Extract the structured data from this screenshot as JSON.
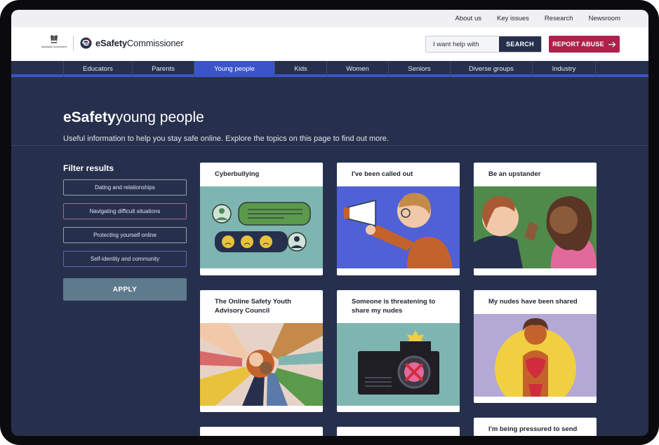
{
  "utility_nav": [
    "About us",
    "Key issues",
    "Research",
    "Newsroom"
  ],
  "header": {
    "crest_text": "Australian Government",
    "brand_bold": "eSafety",
    "brand_rest": "Commissioner",
    "search_placeholder": "I want help with",
    "search_button": "SEARCH",
    "report_button": "REPORT ABUSE"
  },
  "nav": {
    "items": [
      "Educators",
      "Parents",
      "Young people",
      "Kids",
      "Women",
      "Seniors",
      "Diverse groups",
      "Industry"
    ],
    "active": "Young people"
  },
  "hero": {
    "title_bold": "eSafety",
    "title_rest": "young people",
    "subtitle": "Useful information to help you stay safe online. Explore the topics on this page to find out more."
  },
  "filters": {
    "title": "Filter results",
    "options": [
      "Dating and relationships",
      "Navigating difficult situations",
      "Protecting yourself online",
      "Self-identity and community"
    ],
    "apply": "APPLY"
  },
  "cards": [
    {
      "title": "Cyberbullying",
      "icon": "chat-bubbles-illustration",
      "bg": "#7fb5b0"
    },
    {
      "title": "I've been called out",
      "icon": "megaphone-illustration",
      "bg": "#5060d6"
    },
    {
      "title": "Be an upstander",
      "icon": "two-people-illustration",
      "bg": "#4f8a4a"
    },
    {
      "title": "The Online Safety Youth Advisory Council",
      "icon": "hands-together-illustration",
      "bg": "#e7d2c8"
    },
    {
      "title": "Someone is threatening to share my nudes",
      "icon": "camera-illustration",
      "bg": "#7fb5b0"
    },
    {
      "title": "My nudes have been shared",
      "icon": "person-illustration",
      "bg": "#b4a8d4"
    },
    {
      "title": "",
      "icon": "",
      "bg": "#ffffff"
    },
    {
      "title": "",
      "icon": "",
      "bg": "#ffffff"
    },
    {
      "title": "I'm being pressured to send",
      "icon": "",
      "bg": "#ffffff"
    }
  ],
  "colors": {
    "page_bg": "#26304d",
    "accent_blue": "#3b55c8",
    "report_red": "#b0204a",
    "apply_bg": "#5e7b8e"
  }
}
